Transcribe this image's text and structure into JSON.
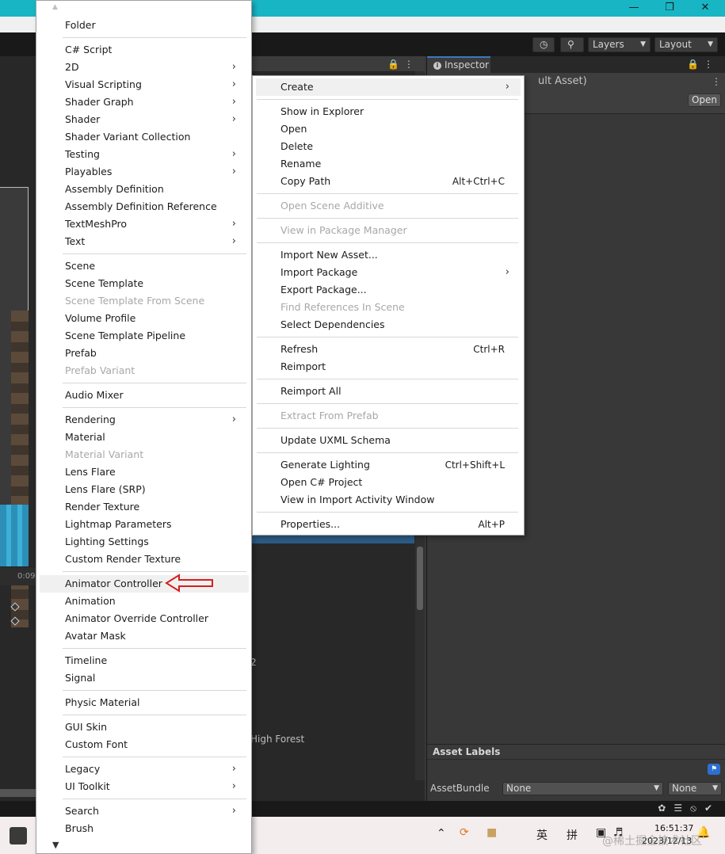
{
  "toolbar": {
    "history_icon": "history-icon",
    "search_icon": "search-icon",
    "layers_label": "Layers",
    "layout_label": "Layout"
  },
  "timeline": {
    "time_label": "0:09"
  },
  "inspector": {
    "tab_label": "Inspector",
    "title_fragment": "ult Asset)",
    "open_label": "Open",
    "asset_labels": "Asset Labels",
    "assetbundle_label": "AssetBundle",
    "bundle_value": "None",
    "variant_value": "None"
  },
  "project_panel": {
    "digit_fragment": "2",
    "folder_fragment": "High Forest"
  },
  "create_menu": {
    "items": [
      {
        "label": "Folder"
      },
      {
        "label": "C# Script"
      },
      {
        "label": "2D",
        "submenu": true
      },
      {
        "label": "Visual Scripting",
        "submenu": true
      },
      {
        "label": "Shader Graph",
        "submenu": true
      },
      {
        "label": "Shader",
        "submenu": true
      },
      {
        "label": "Shader Variant Collection"
      },
      {
        "label": "Testing",
        "submenu": true
      },
      {
        "label": "Playables",
        "submenu": true
      },
      {
        "label": "Assembly Definition"
      },
      {
        "label": "Assembly Definition Reference"
      },
      {
        "label": "TextMeshPro",
        "submenu": true
      },
      {
        "label": "Text",
        "submenu": true
      },
      {
        "label": "Scene"
      },
      {
        "label": "Scene Template"
      },
      {
        "label": "Scene Template From Scene",
        "disabled": true
      },
      {
        "label": "Volume Profile"
      },
      {
        "label": "Scene Template Pipeline"
      },
      {
        "label": "Prefab"
      },
      {
        "label": "Prefab Variant",
        "disabled": true
      },
      {
        "label": "Audio Mixer"
      },
      {
        "label": "Rendering",
        "submenu": true
      },
      {
        "label": "Material"
      },
      {
        "label": "Material Variant",
        "disabled": true
      },
      {
        "label": "Lens Flare"
      },
      {
        "label": "Lens Flare (SRP)"
      },
      {
        "label": "Render Texture"
      },
      {
        "label": "Lightmap Parameters"
      },
      {
        "label": "Lighting Settings"
      },
      {
        "label": "Custom Render Texture"
      },
      {
        "label": "Animator Controller",
        "highlighted": true
      },
      {
        "label": "Animation"
      },
      {
        "label": "Animator Override Controller"
      },
      {
        "label": "Avatar Mask"
      },
      {
        "label": "Timeline"
      },
      {
        "label": "Signal"
      },
      {
        "label": "Physic Material"
      },
      {
        "label": "GUI Skin"
      },
      {
        "label": "Custom Font"
      },
      {
        "label": "Legacy",
        "submenu": true
      },
      {
        "label": "UI Toolkit",
        "submenu": true
      },
      {
        "label": "Search",
        "submenu": true
      },
      {
        "label": "Brush"
      }
    ]
  },
  "context_menu": {
    "items": [
      {
        "label": "Create",
        "submenu": true,
        "highlighted": true
      },
      {
        "label": "Show in Explorer"
      },
      {
        "label": "Open"
      },
      {
        "label": "Delete"
      },
      {
        "label": "Rename"
      },
      {
        "label": "Copy Path",
        "shortcut": "Alt+Ctrl+C"
      },
      {
        "label": "Open Scene Additive",
        "disabled": true
      },
      {
        "label": "View in Package Manager",
        "disabled": true
      },
      {
        "label": "Import New Asset..."
      },
      {
        "label": "Import Package",
        "submenu": true
      },
      {
        "label": "Export Package..."
      },
      {
        "label": "Find References In Scene",
        "disabled": true
      },
      {
        "label": "Select Dependencies"
      },
      {
        "label": "Refresh",
        "shortcut": "Ctrl+R"
      },
      {
        "label": "Reimport"
      },
      {
        "label": "Reimport All"
      },
      {
        "label": "Extract From Prefab",
        "disabled": true
      },
      {
        "label": "Update UXML Schema"
      },
      {
        "label": "Generate Lighting",
        "shortcut": "Ctrl+Shift+L"
      },
      {
        "label": "Open C# Project"
      },
      {
        "label": "View in Import Activity Window"
      },
      {
        "label": "Properties...",
        "shortcut": "Alt+P"
      }
    ]
  },
  "taskbar": {
    "ime_english": "英",
    "ime_pinyin": "拼",
    "time": "16:51:37",
    "date": "2023/12/13",
    "watermark": "@稀土掘金技术社区"
  },
  "colors": {
    "titlebar": "#18b6c4",
    "selection": "#2c5d87",
    "annotation_arrow": "#d42020"
  }
}
